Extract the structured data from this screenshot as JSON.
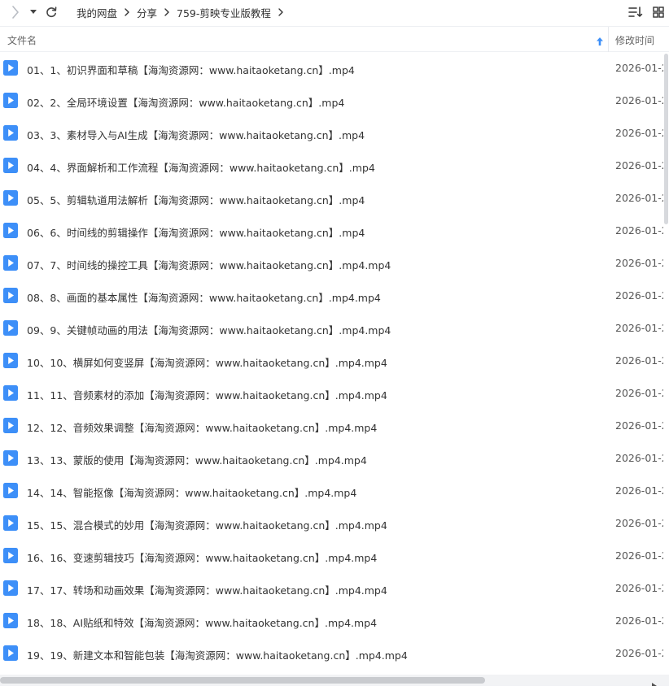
{
  "breadcrumb": {
    "items": [
      "我的网盘",
      "分享",
      "759-剪映专业版教程"
    ]
  },
  "columns": {
    "name": "文件名",
    "modified": "修改时间"
  },
  "colors": {
    "file_icon": "#3d8ff8",
    "sort_arrow": "#3d8ff8"
  },
  "icons": {
    "forward": "chevron-right-icon",
    "dropdown": "caret-down-icon",
    "refresh": "refresh-icon",
    "sort": "sort-icon",
    "grid": "grid-view-icon",
    "file": "video-file-icon"
  },
  "files": [
    {
      "name": "01、1、初识界面和草稿【海淘资源网：www.haitaoketang.cn】.mp4",
      "date": "2026-01-2"
    },
    {
      "name": "02、2、全局环境设置【海淘资源网：www.haitaoketang.cn】.mp4",
      "date": "2026-01-2"
    },
    {
      "name": "03、3、素材导入与AI生成【海淘资源网：www.haitaoketang.cn】.mp4",
      "date": "2026-01-2"
    },
    {
      "name": "04、4、界面解析和工作流程【海淘资源网：www.haitaoketang.cn】.mp4",
      "date": "2026-01-2"
    },
    {
      "name": "05、5、剪辑轨道用法解析【海淘资源网：www.haitaoketang.cn】.mp4",
      "date": "2026-01-2"
    },
    {
      "name": "06、6、时间线的剪辑操作【海淘资源网：www.haitaoketang.cn】.mp4",
      "date": "2026-01-2"
    },
    {
      "name": "07、7、时间线的操控工具【海淘资源网：www.haitaoketang.cn】.mp4.mp4",
      "date": "2026-01-2"
    },
    {
      "name": "08、8、画面的基本属性【海淘资源网：www.haitaoketang.cn】.mp4.mp4",
      "date": "2026-01-2"
    },
    {
      "name": "09、9、关键帧动画的用法【海淘资源网：www.haitaoketang.cn】.mp4.mp4",
      "date": "2026-01-2"
    },
    {
      "name": "10、10、横屏如何变竖屏【海淘资源网：www.haitaoketang.cn】.mp4.mp4",
      "date": "2026-01-2"
    },
    {
      "name": "11、11、音频素材的添加【海淘资源网：www.haitaoketang.cn】.mp4.mp4",
      "date": "2026-01-2"
    },
    {
      "name": "12、12、音频效果调整【海淘资源网：www.haitaoketang.cn】.mp4.mp4",
      "date": "2026-01-2"
    },
    {
      "name": "13、13、蒙版的使用【海淘资源网：www.haitaoketang.cn】.mp4.mp4",
      "date": "2026-01-2"
    },
    {
      "name": "14、14、智能抠像【海淘资源网：www.haitaoketang.cn】.mp4.mp4",
      "date": "2026-01-2"
    },
    {
      "name": "15、15、混合模式的妙用【海淘资源网：www.haitaoketang.cn】.mp4.mp4",
      "date": "2026-01-2"
    },
    {
      "name": "16、16、变速剪辑技巧【海淘资源网：www.haitaoketang.cn】.mp4.mp4",
      "date": "2026-01-2"
    },
    {
      "name": "17、17、转场和动画效果【海淘资源网：www.haitaoketang.cn】.mp4.mp4",
      "date": "2026-01-2"
    },
    {
      "name": "18、18、AI贴纸和特效【海淘资源网：www.haitaoketang.cn】.mp4.mp4",
      "date": "2026-01-2"
    },
    {
      "name": "19、19、新建文本和智能包装【海淘资源网：www.haitaoketang.cn】.mp4.mp4",
      "date": "2026-01-2"
    }
  ]
}
